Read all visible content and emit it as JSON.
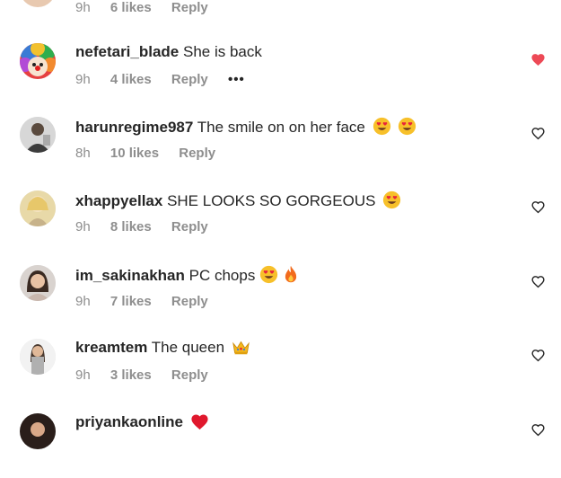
{
  "top_partial": {
    "time": "9h",
    "likes": "6 likes",
    "reply": "Reply"
  },
  "comments": [
    {
      "username": "nefetari_blade",
      "text": "She is back",
      "time": "9h",
      "likes": "4 likes",
      "reply": "Reply",
      "more": "•••",
      "liked": true
    },
    {
      "username": "harunregime987",
      "text": "The smile on on her face",
      "time": "8h",
      "likes": "10 likes",
      "reply": "Reply",
      "liked": false
    },
    {
      "username": "xhappyellax",
      "text": "SHE LOOKS SO GORGEOUS",
      "time": "9h",
      "likes": "8 likes",
      "reply": "Reply",
      "liked": false
    },
    {
      "username": "im_sakinakhan",
      "text": "PC chops",
      "time": "9h",
      "likes": "7 likes",
      "reply": "Reply",
      "liked": false
    },
    {
      "username": "kreamtem",
      "text": "The queen",
      "time": "9h",
      "likes": "3 likes",
      "reply": "Reply",
      "liked": false
    },
    {
      "username": "priyankaonline",
      "text": "",
      "time": "",
      "likes": "",
      "reply": "",
      "liked": false
    }
  ],
  "colors": {
    "liked_heart": "#ed4956",
    "meta_text": "#8e8e8e",
    "text": "#262626"
  }
}
